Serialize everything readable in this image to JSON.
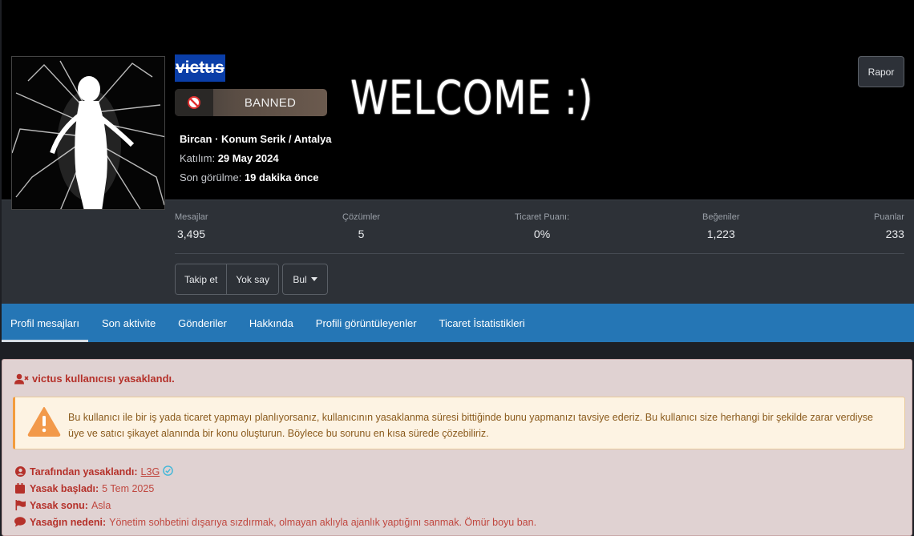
{
  "profile": {
    "username": "victus",
    "badge_label": "BANNED",
    "name": "Bircan",
    "location": "Konum Serik / Antalya",
    "joined_label": "Katılım:",
    "joined_value": "29 May 2024",
    "last_seen_label": "Son görülme:",
    "last_seen_value": "19 dakika önce",
    "banner_text": "WELCOME :)",
    "report_label": "Rapor"
  },
  "stats": [
    {
      "label": "Mesajlar",
      "value": "3,495"
    },
    {
      "label": "Çözümler",
      "value": "5"
    },
    {
      "label": "Ticaret Puanı:",
      "value": "0%"
    },
    {
      "label": "Beğeniler",
      "value": "1,223"
    },
    {
      "label": "Puanlar",
      "value": "233"
    }
  ],
  "actions": {
    "follow": "Takip et",
    "ignore": "Yok say",
    "find": "Bul"
  },
  "tabs": [
    {
      "label": "Profil mesajları"
    },
    {
      "label": "Son aktivite"
    },
    {
      "label": "Gönderiler"
    },
    {
      "label": "Hakkında"
    },
    {
      "label": "Profili görüntüleyenler"
    },
    {
      "label": "Ticaret İstatistikleri"
    }
  ],
  "ban_notice": {
    "title": "victus kullanıcısı yasaklandı.",
    "warning": "Bu kullanıcı ile bir iş yada ticaret yapmayı planlıyorsanız, kullanıcının yasaklanma süresi bittiğinde bunu yapmanızı tavsiye ederiz. Bu kullanıcı size herhangi bir şekilde zarar verdiyse üye ve satıcı şikayet alanında bir konu oluşturun. Böylece bu sorunu en kısa sürede çözebiliriz.",
    "banned_by_label": "Tarafından yasaklandı:",
    "banned_by_value": "L3G",
    "start_label": "Yasak başladı:",
    "start_value": "5 Tem 2025",
    "end_label": "Yasak sonu:",
    "end_value": "Asla",
    "reason_label": "Yasağın nedeni:",
    "reason_value": "Yönetim sohbetini dışarıya sızdırmak, olmayan aklıyla ajanlık yaptığını sanmak. Ömür boyu ban."
  },
  "colors": {
    "tab_bar": "#2576b5",
    "notice_bg": "#e0d2d2",
    "notice_text": "#b5312a",
    "warning_accent": "#f39c3d"
  }
}
